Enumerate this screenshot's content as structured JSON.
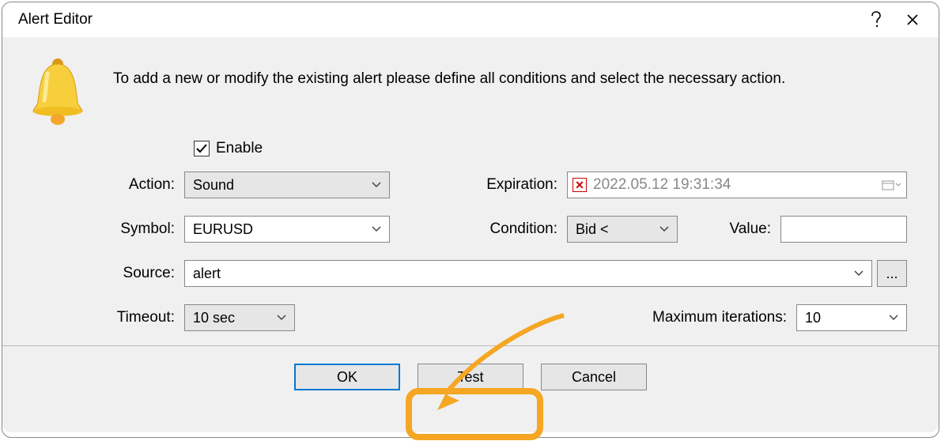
{
  "title": "Alert Editor",
  "intro": "To add a new or modify the existing alert please define all conditions and select the necessary action.",
  "enable": {
    "label": "Enable",
    "checked": true
  },
  "labels": {
    "action": "Action:",
    "symbol": "Symbol:",
    "source": "Source:",
    "timeout": "Timeout:",
    "expiration": "Expiration:",
    "condition": "Condition:",
    "value": "Value:",
    "max_iter": "Maximum iterations:"
  },
  "fields": {
    "action": "Sound",
    "symbol": "EURUSD",
    "source": "alert",
    "timeout": "10 sec",
    "expiration": "2022.05.12 19:31:34",
    "condition": "Bid <",
    "value": "",
    "max_iter": "10"
  },
  "buttons": {
    "ok": "OK",
    "test": "Test",
    "cancel": "Cancel",
    "browse": "..."
  }
}
